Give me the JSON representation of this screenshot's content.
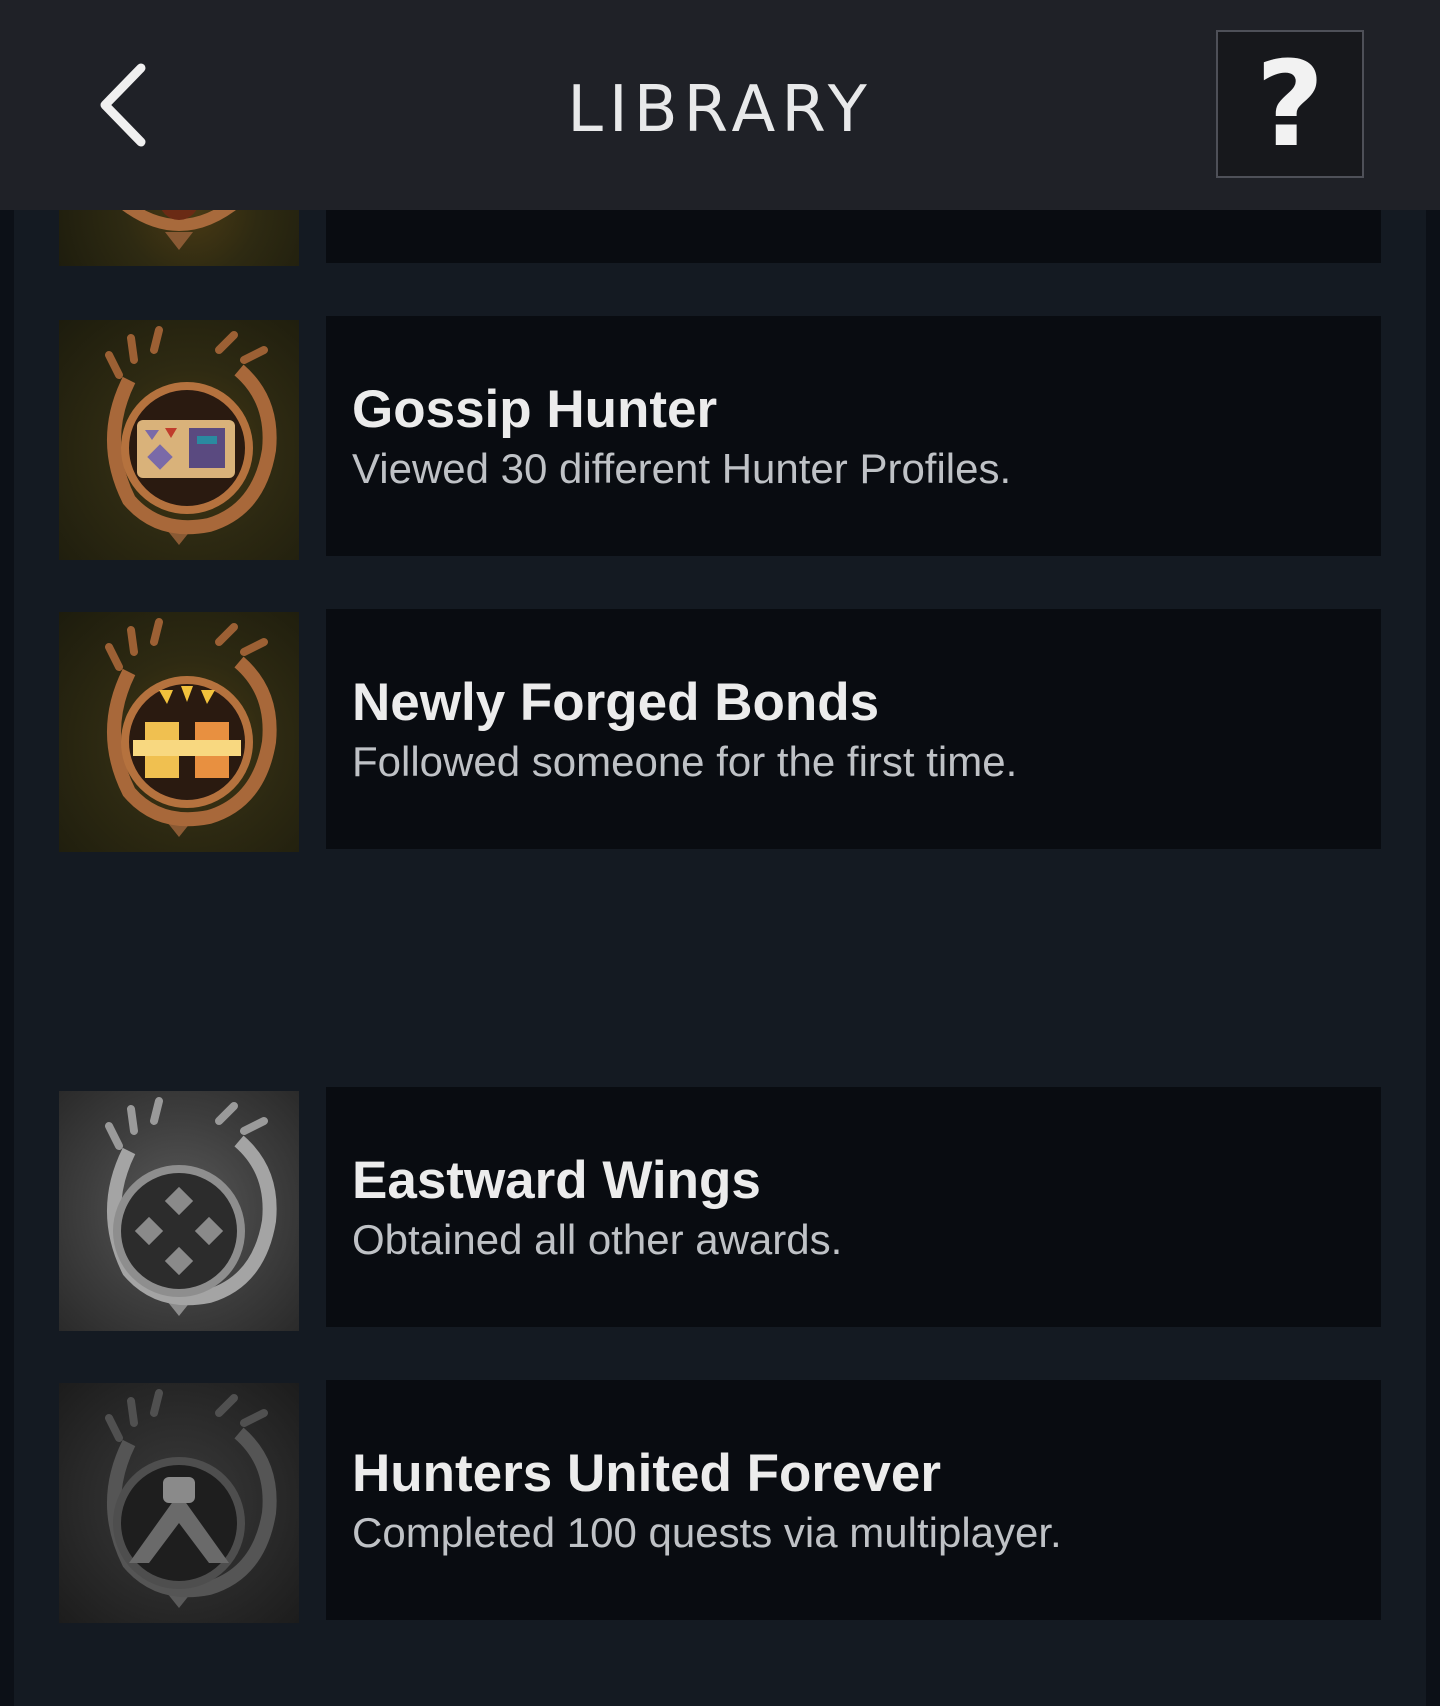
{
  "header": {
    "title": "LIBRARY",
    "help_label": "?"
  },
  "awards": [
    {
      "title": "Gossip Hunter",
      "description": "Viewed 30 different Hunter Profiles.",
      "status": "unlocked",
      "icon": "scroll-badge-icon"
    },
    {
      "title": "Newly Forged Bonds",
      "description": "Followed someone for the first time.",
      "status": "unlocked",
      "icon": "handshake-badge-icon"
    },
    {
      "title": "Eastward Wings",
      "description": "Obtained all other awards.",
      "status": "locked",
      "icon": "diamond-crest-badge-icon"
    },
    {
      "title": "Hunters United Forever",
      "description": "Completed 100 quests via multiplayer.",
      "status": "locked",
      "icon": "arm-clasp-badge-icon"
    }
  ],
  "colors": {
    "header_bg": "#1f2127",
    "panel_bg": "#141a22",
    "card_bg": "#090c11",
    "badge_gold": "#b5723e",
    "badge_grey": "#9a9a9a"
  }
}
